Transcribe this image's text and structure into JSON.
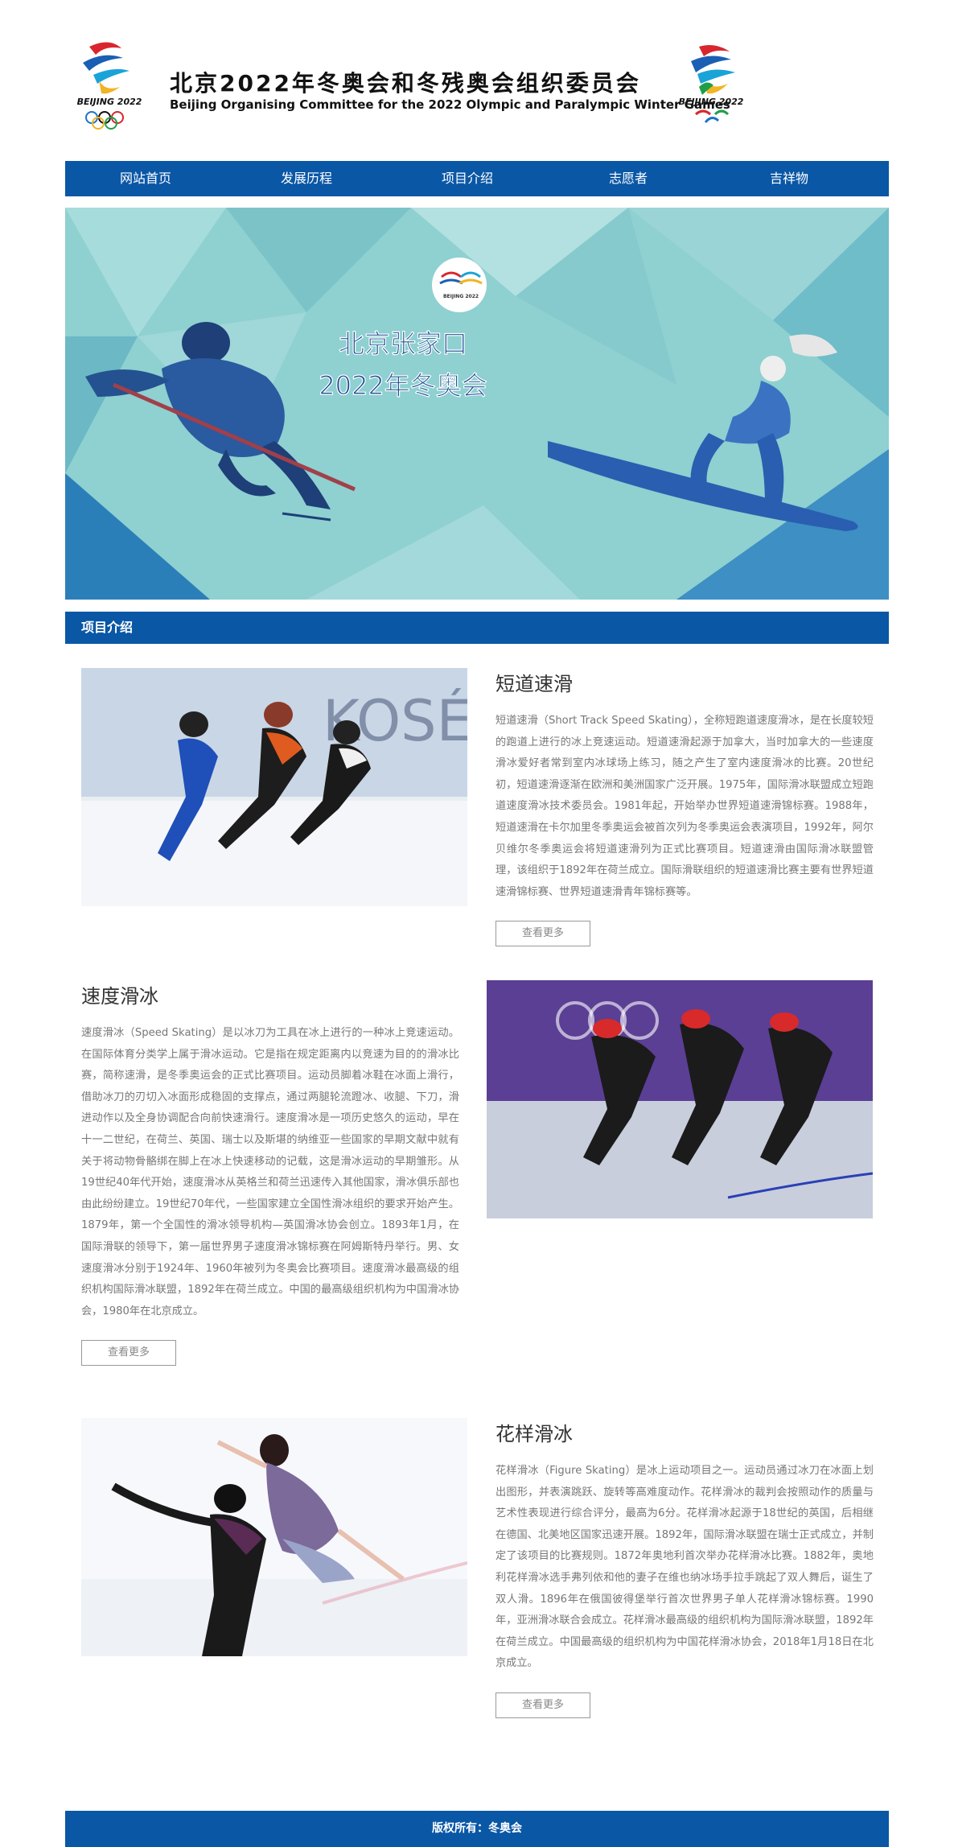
{
  "header": {
    "title": "北京2022年冬奥会和冬残奥会组织委员会",
    "subtitle": "Beijing Organising Committee for the 2022 Olympic and Paralympic Winter Games",
    "logo_text": "BEIJING 2022"
  },
  "nav": {
    "items": [
      {
        "label": "网站首页"
      },
      {
        "label": "发展历程"
      },
      {
        "label": "项目介绍"
      },
      {
        "label": "志愿者"
      },
      {
        "label": "吉祥物"
      }
    ]
  },
  "banner": {
    "line1": "北京张家口",
    "line2": "2022年冬奥会",
    "logo_text": "BEIJING 2022"
  },
  "section": {
    "title": "项目介绍"
  },
  "items": [
    {
      "title": "短道速滑",
      "desc": "短道速滑（Short Track Speed Skating），全称短跑道速度滑冰，是在长度较短的跑道上进行的冰上竞速运动。短道速滑起源于加拿大，当时加拿大的一些速度滑冰爱好者常到室内冰球场上练习，随之产生了室内速度滑冰的比赛。20世纪初，短道速滑逐渐在欧洲和美洲国家广泛开展。1975年，国际滑冰联盟成立短跑道速度滑冰技术委员会。1981年起，开始举办世界短道速滑锦标赛。1988年，短道速滑在卡尔加里冬季奥运会被首次列为冬季奥运会表演项目，1992年，阿尔贝维尔冬季奥运会将短道速滑列为正式比赛项目。短道速滑由国际滑冰联盟管理，该组织于1892年在荷兰成立。国际滑联组织的短道速滑比赛主要有世界短道速滑锦标赛、世界短道速滑青年锦标赛等。",
      "more": "查看更多",
      "photo_text": "KOSÉ"
    },
    {
      "title": "速度滑冰",
      "desc": "速度滑冰（Speed Skating）是以冰刀为工具在冰上进行的一种冰上竞速运动。在国际体育分类学上属于滑冰运动。它是指在规定距离内以竞速为目的的滑冰比赛，简称速滑，是冬季奥运会的正式比赛项目。运动员脚着冰鞋在冰面上滑行，借助冰刀的刃切入冰面形成稳固的支撑点，通过两腿轮流蹬冰、收腿、下刀，滑进动作以及全身协调配合向前快速滑行。速度滑冰是一项历史悠久的运动，早在十一二世纪，在荷兰、英国、瑞士以及斯堪的纳维亚一些国家的早期文献中就有关于将动物骨骼绑在脚上在冰上快速移动的记载，这是滑冰运动的早期雏形。从19世纪40年代开始，速度滑冰从英格兰和荷兰迅速传入其他国家，滑冰俱乐部也由此纷纷建立。19世纪70年代，一些国家建立全国性滑冰组织的要求开始产生。1879年，第一个全国性的滑冰领导机构—英国滑冰协会创立。1893年1月，在国际滑联的领导下，第一届世界男子速度滑冰锦标赛在阿姆斯特丹举行。男、女速度滑冰分别于1924年、1960年被列为冬奥会比赛项目。速度滑冰最高级的组织机构国际滑冰联盟，1892年在荷兰成立。中国的最高级组织机构为中国滑冰协会，1980年在北京成立。",
      "more": "查看更多",
      "photo_text": ""
    },
    {
      "title": "花样滑冰",
      "desc": "花样滑冰（Figure Skating）是冰上运动项目之一。运动员通过冰刀在冰面上划出图形，并表演跳跃、旋转等高难度动作。花样滑冰的裁判会按照动作的质量与艺术性表现进行综合评分，最高为6分。花样滑冰起源于18世纪的英国，后相继在德国、北美地区国家迅速开展。1892年，国际滑冰联盟在瑞士正式成立，并制定了该项目的比赛规则。1872年奥地利首次举办花样滑冰比赛。1882年，奥地利花样滑冰选手弗列依和他的妻子在维也纳冰场手拉手跳起了双人舞后，诞生了双人滑。1896年在俄国彼得堡举行首次世界男子单人花样滑冰锦标赛。1990年，亚洲滑冰联合会成立。花样滑冰最高级的组织机构为国际滑冰联盟，1892年在荷兰成立。中国最高级的组织机构为中国花样滑冰协会，2018年1月18日在北京成立。",
      "more": "查看更多",
      "photo_text": ""
    }
  ],
  "footer": {
    "text": "版权所有：冬奥会"
  },
  "colors": {
    "primary": "#0a57a6",
    "banner_bg": "#8fd0d0",
    "text_gray": "#777777"
  }
}
